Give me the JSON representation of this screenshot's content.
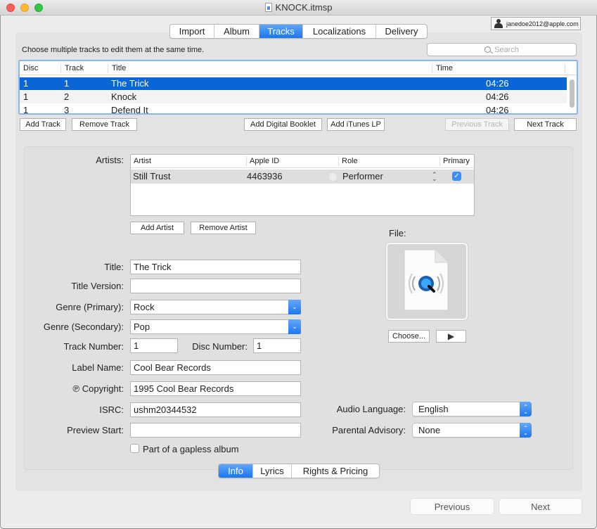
{
  "window": {
    "title": "KNOCK.itmsp",
    "traffic_lights": {
      "close": "#fc5f57",
      "minimize": "#fdbc2e",
      "zoom": "#33c748"
    }
  },
  "account": {
    "icon": "person-icon",
    "email": "janedoe2012@apple.com"
  },
  "top_tabs": [
    {
      "label": "Import",
      "active": false
    },
    {
      "label": "Album",
      "active": false
    },
    {
      "label": "Tracks",
      "active": true
    },
    {
      "label": "Localizations",
      "active": false
    },
    {
      "label": "Delivery",
      "active": false
    }
  ],
  "tracks": {
    "hint": "Choose multiple tracks to edit them at the same time.",
    "search_placeholder": "Search",
    "columns": [
      "Disc",
      "Track",
      "Title",
      "Time"
    ],
    "rows": [
      {
        "disc": "1",
        "track": "1",
        "title": "The Trick",
        "time": "04:26",
        "selected": true
      },
      {
        "disc": "1",
        "track": "2",
        "title": "Knock",
        "time": "04:26",
        "selected": false
      },
      {
        "disc": "1",
        "track": "3",
        "title": "Defend It",
        "time": "04:26",
        "selected": false
      }
    ],
    "buttons": {
      "add_track": "Add Track",
      "remove_track": "Remove Track",
      "add_digital_booklet": "Add Digital Booklet",
      "add_itunes_lp": "Add iTunes LP",
      "previous_track": "Previous Track",
      "next_track": "Next Track"
    }
  },
  "artists": {
    "label": "Artists:",
    "columns": [
      "Artist",
      "Apple ID",
      "Role",
      "Primary"
    ],
    "rows": [
      {
        "artist": "Still Trust",
        "apple_id": "4463936",
        "role": "Performer",
        "primary": true
      }
    ],
    "add_button": "Add Artist",
    "remove_button": "Remove Artist"
  },
  "file": {
    "label": "File:",
    "icon": "quicktime-audio-file-icon",
    "choose_button": "Choose...",
    "play_icon": "▶"
  },
  "form": {
    "title_label": "Title:",
    "title_value": "The Trick",
    "title_version_label": "Title Version:",
    "title_version_value": "",
    "genre_primary_label": "Genre (Primary):",
    "genre_primary_value": "Rock",
    "genre_secondary_label": "Genre (Secondary):",
    "genre_secondary_value": "Pop",
    "track_number_label": "Track Number:",
    "track_number_value": "1",
    "disc_number_label": "Disc Number:",
    "disc_number_value": "1",
    "label_name_label": "Label Name:",
    "label_name_value": "Cool Bear Records",
    "copyright_label": "℗ Copyright:",
    "copyright_value": "1995 Cool Bear Records",
    "isrc_label": "ISRC:",
    "isrc_value": "ushm20344532",
    "preview_start_label": "Preview Start:",
    "preview_start_value": "",
    "gapless_label": "Part of a gapless album",
    "gapless_checked": false,
    "audio_language_label": "Audio Language:",
    "audio_language_value": "English",
    "parental_advisory_label": "Parental Advisory:",
    "parental_advisory_value": "None"
  },
  "bottom_tabs": [
    {
      "label": "Info",
      "active": true
    },
    {
      "label": "Lyrics",
      "active": false
    },
    {
      "label": "Rights & Pricing",
      "active": false
    }
  ],
  "nav": {
    "previous": "Previous",
    "next": "Next"
  },
  "colors": {
    "accent": "#1b76ef",
    "selection": "#0a66d6",
    "table_focus": "#8ab6ec"
  }
}
